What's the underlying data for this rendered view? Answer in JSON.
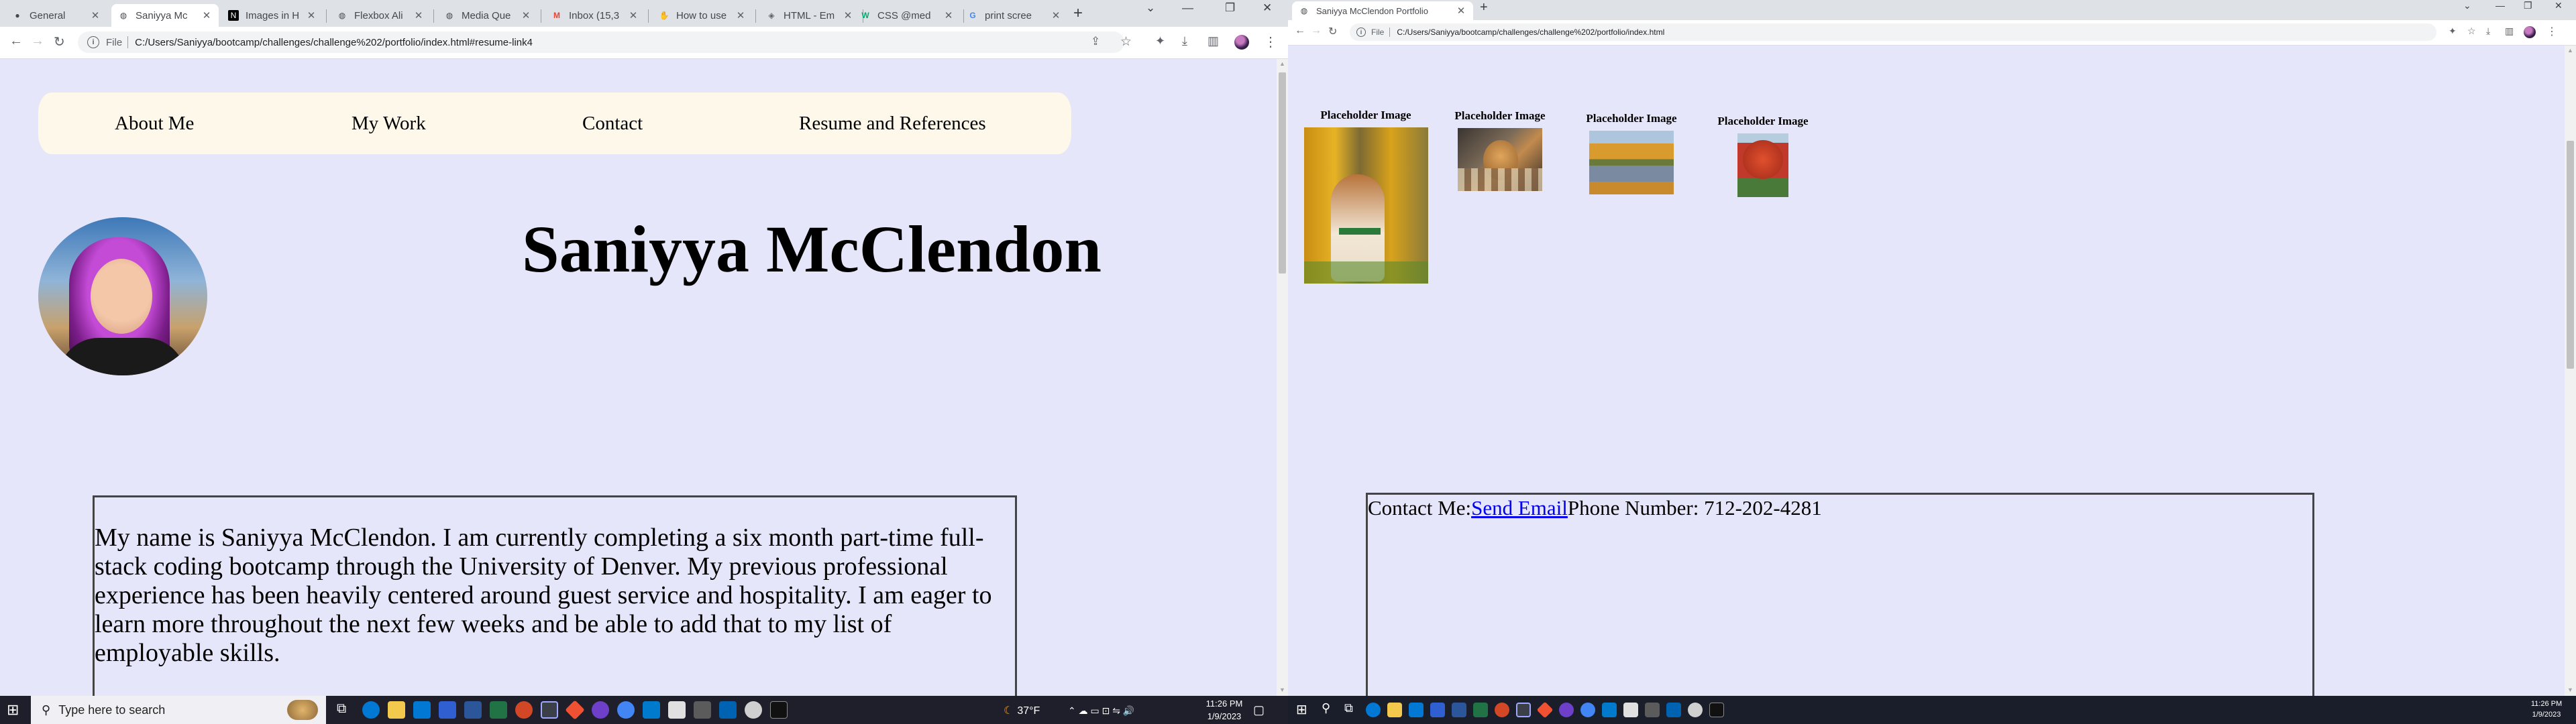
{
  "left_window": {
    "tabs": [
      {
        "title": "General",
        "icon": "github-icon",
        "active": false
      },
      {
        "title": "Saniyya Mc",
        "icon": "globe-icon",
        "active": true
      },
      {
        "title": "Images in H",
        "icon": "notion-icon",
        "active": false
      },
      {
        "title": "Flexbox Ali",
        "icon": "globe-icon",
        "active": false
      },
      {
        "title": "Media Que",
        "icon": "globe-icon",
        "active": false
      },
      {
        "title": "Inbox (15,3",
        "icon": "gmail-icon",
        "active": false
      },
      {
        "title": "How to use",
        "icon": "hand-icon",
        "active": false
      },
      {
        "title": "HTML - Em",
        "icon": "diamond-icon",
        "active": false
      },
      {
        "title": "CSS @med",
        "icon": "w3-icon",
        "active": false
      },
      {
        "title": "print scree",
        "icon": "google-icon",
        "active": false
      }
    ],
    "address_prefix": "File",
    "url": "C:/Users/Saniyya/bootcamp/challenges/challenge%202/portfolio/index.html#resume-link4",
    "nav_links": [
      "About Me",
      "My Work",
      "Contact",
      "Resume and References"
    ],
    "name_heading": "Saniyya McClendon",
    "bio_text": "My name is Saniyya McClendon. I am currently completing a six month part-time full-stack coding bootcamp through the University of Denver. My previous professional experience has been heavily centered around guest service and hospitality. I am eager to learn more throughout the next few weeks and be able to add that to my list of employable skills."
  },
  "right_window": {
    "tab_title": "Saniyya McClendon Portfolio",
    "address_prefix": "File",
    "url": "C:/Users/Saniyya/bootcamp/challenges/challenge%202/portfolio/index.html",
    "gallery": [
      {
        "caption": "Placeholder Image",
        "subject": "dog-in-autumn-woods"
      },
      {
        "caption": "Placeholder Image",
        "subject": "cat-on-blanket"
      },
      {
        "caption": "Placeholder Image",
        "subject": "autumn-pond-reflection"
      },
      {
        "caption": "Placeholder Image",
        "subject": "red-autumn-tree"
      }
    ],
    "contact_label": "Contact Me:",
    "contact_link": "Send Email",
    "contact_phone": "Phone Number: 712-202-4281"
  },
  "taskbar_left": {
    "search_placeholder": "Type here to search",
    "weather": "37°F",
    "time": "11:26 PM",
    "date": "1/9/2023"
  },
  "taskbar_right": {
    "time": "11:26 PM",
    "date": "1/9/2023"
  },
  "colors": {
    "page_background": "#e6e6fa",
    "nav_background": "#fdf8ea",
    "link": "#0000ee",
    "taskbar": "#1f1f2b"
  }
}
